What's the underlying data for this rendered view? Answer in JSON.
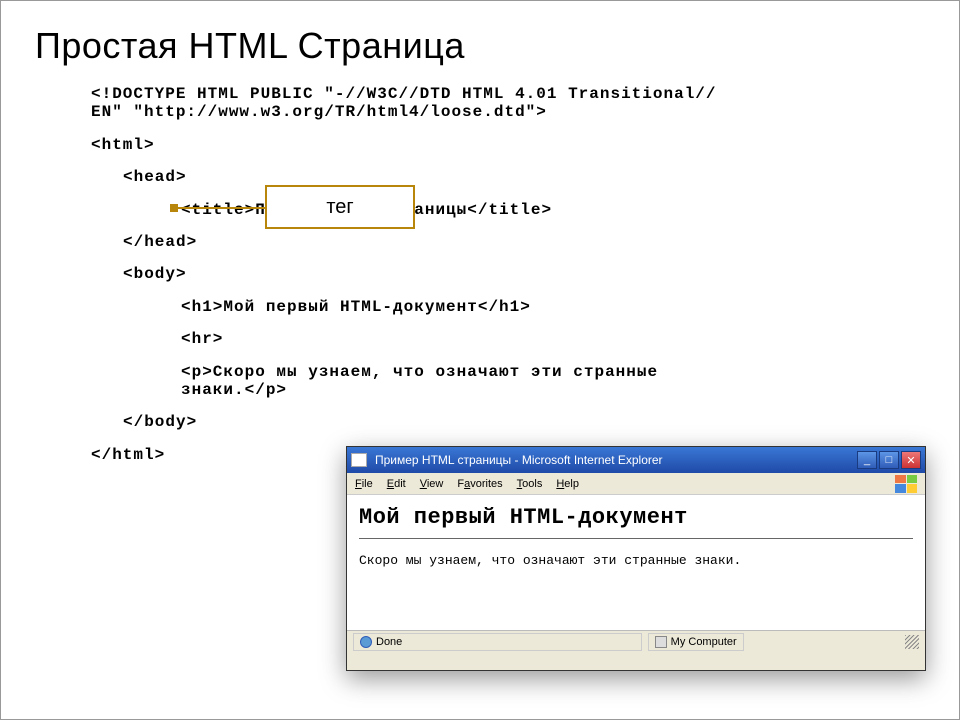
{
  "title": "Простая HTML Страница",
  "callout": {
    "label": "тег"
  },
  "code": {
    "doctype": "<!DOCTYPE HTML PUBLIC \"-//W3C//DTD HTML 4.01 Transitional//\nEN\" \"http://www.w3.org/TR/html4/loose.dtd\">",
    "html_open": "<html>",
    "head_open": "<head>",
    "title_line": "<title>Пример HTML страницы</title>",
    "head_close": "</head>",
    "body_open": "<body>",
    "h1_line": "<h1>Мой первый HTML-документ</h1>",
    "hr_line": "<hr>",
    "p_line": "<p>Скоро мы узнаем, что означают эти странные\nзнаки.</p>",
    "body_close": "</body>",
    "html_close": "</html>"
  },
  "browser": {
    "title": "Пример HTML страницы - Microsoft Internet Explorer",
    "menu": {
      "file": "File",
      "edit": "Edit",
      "view": "View",
      "favorites": "Favorites",
      "tools": "Tools",
      "help": "Help"
    },
    "page": {
      "h1": "Мой первый HTML-документ",
      "p": "Скоро мы узнаем, что означают эти странные знаки."
    },
    "status": {
      "done": "Done",
      "location": "My Computer"
    },
    "winbtns": {
      "min": "_",
      "max": "□",
      "close": "✕"
    }
  }
}
